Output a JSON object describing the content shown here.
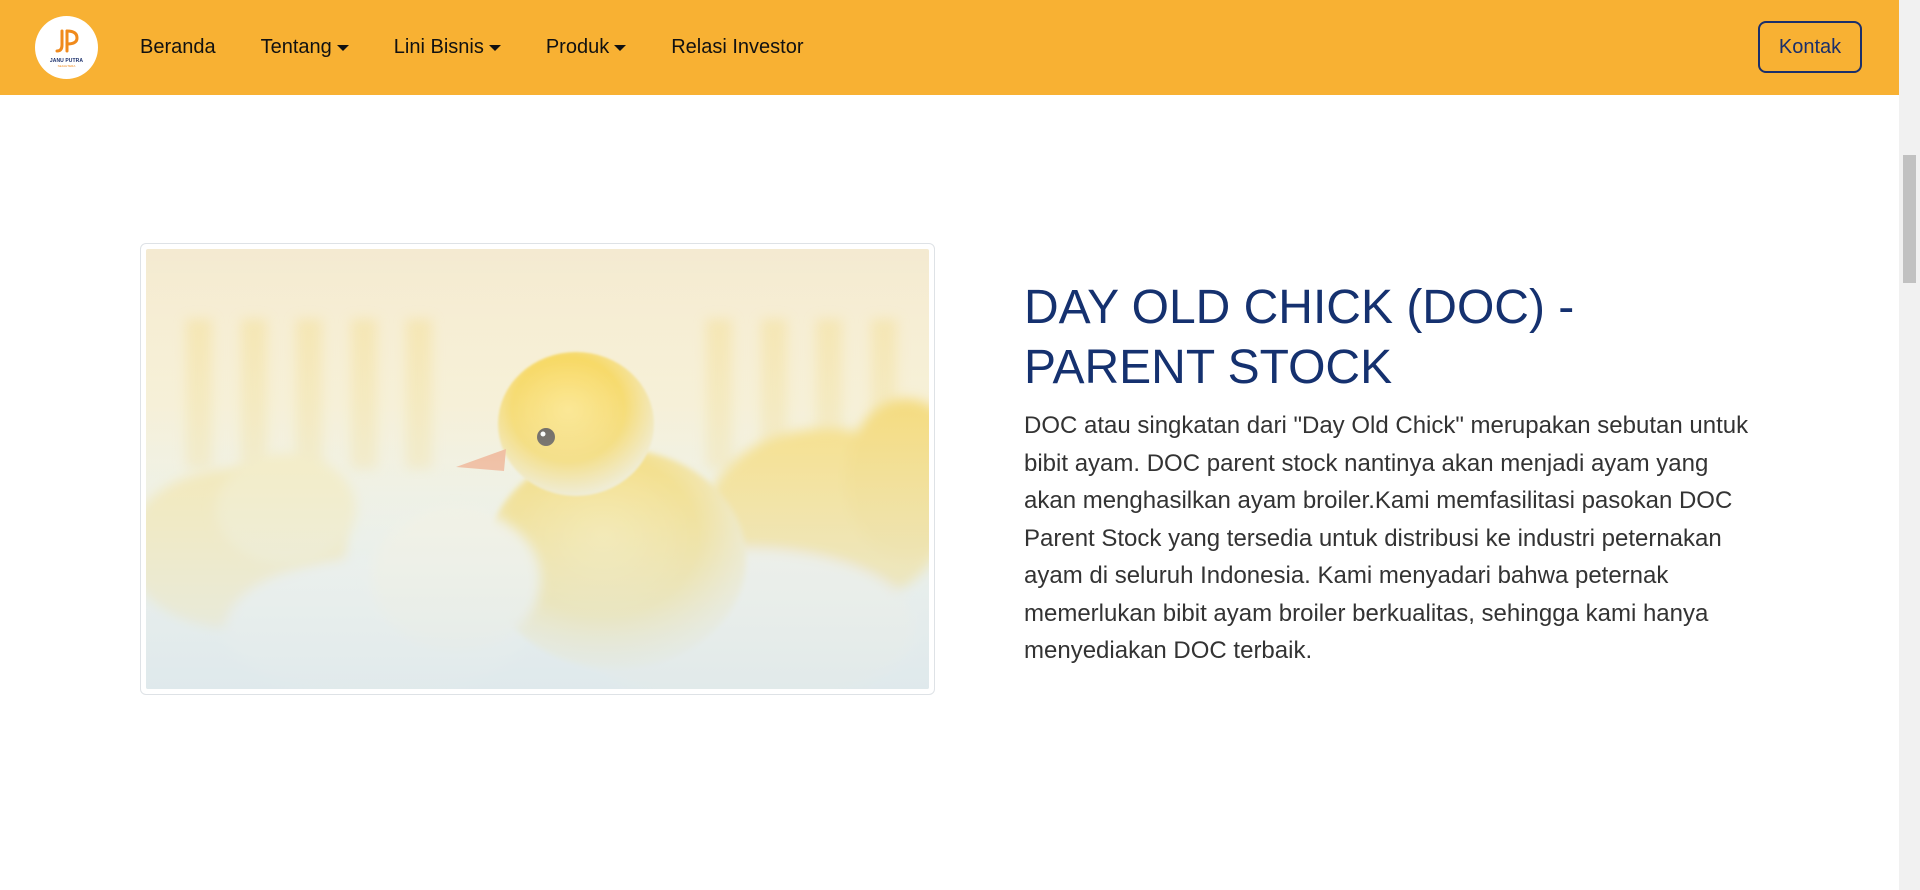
{
  "navbar": {
    "logo": {
      "name": "JANU PUTRA",
      "subtitle": "SEJAHTERA",
      "icon": "janu-putra-logo-icon"
    },
    "menu": [
      {
        "label": "Beranda",
        "has_dropdown": false
      },
      {
        "label": "Tentang",
        "has_dropdown": true
      },
      {
        "label": "Lini Bisnis",
        "has_dropdown": true
      },
      {
        "label": "Produk",
        "has_dropdown": true
      },
      {
        "label": "Relasi Investor",
        "has_dropdown": false
      }
    ],
    "contact_label": "Kontak"
  },
  "product": {
    "title": "DAY OLD CHICK (DOC) - PARENT STOCK",
    "description": "DOC atau singkatan dari \"Day Old Chick\" merupakan sebutan untuk bibit ayam. DOC parent stock nantinya akan menjadi ayam yang akan menghasilkan ayam broiler.Kami memfasilitasi pasokan DOC Parent Stock yang tersedia untuk distribusi ke industri peternakan ayam di seluruh Indonesia. Kami menyadari bahwa peternak memerlukan bibit ayam broiler berkualitas, sehingga kami hanya menyediakan DOC terbaik."
  },
  "colors": {
    "navbar_bg": "#f8b133",
    "brand_blue": "#15316f",
    "text": "#333333",
    "logo_orange": "#f08a1c"
  }
}
